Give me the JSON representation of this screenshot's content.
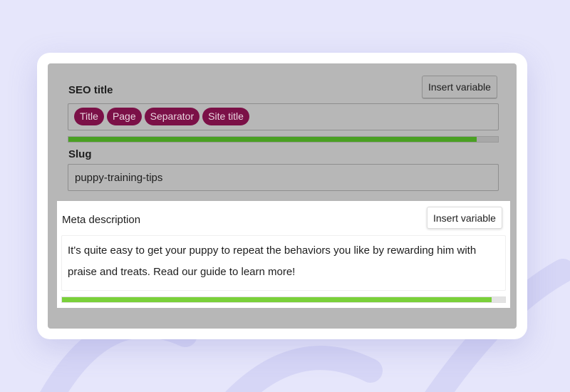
{
  "seo_title": {
    "label": "SEO title",
    "insert_button": "Insert variable",
    "variables": [
      "Title",
      "Page",
      "Separator",
      "Site title"
    ],
    "progress": 0.95,
    "progress_color": "#4aa023"
  },
  "slug": {
    "label": "Slug",
    "value": "puppy-training-tips"
  },
  "meta_description": {
    "label": "Meta description",
    "insert_button": "Insert variable",
    "value": "It's quite easy to get your puppy to repeat the behaviors you like by rewarding him with praise and treats. Read our guide to learn more!",
    "progress": 0.97,
    "progress_color": "#7ad03a"
  },
  "colors": {
    "background": "#e6e6fb",
    "overlay": "#b7b7b7",
    "pill": "#7b1047"
  }
}
